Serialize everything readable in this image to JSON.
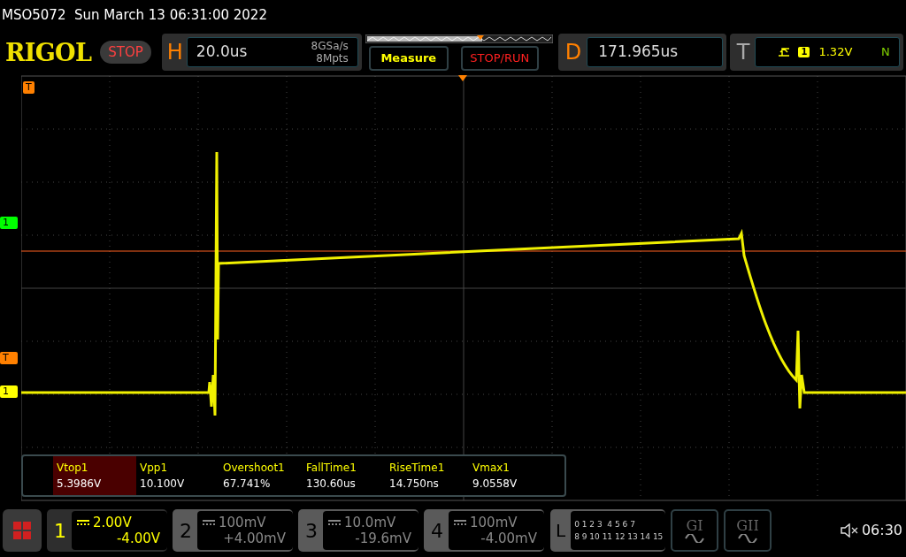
{
  "title": "MSO5072  Sun March 13 06:31:00 2022",
  "logo": "RIGOL",
  "run_state": "STOP",
  "horizontal": {
    "label": "H",
    "timebase": "20.0us",
    "sample_rate": "8GSa/s",
    "memory_depth": "8Mpts"
  },
  "buttons": [
    "Measure",
    "STOP/RUN"
  ],
  "delay": {
    "label": "D",
    "value": "171.965us"
  },
  "trigger": {
    "label": "T",
    "source": "1",
    "level": "1.32V",
    "mode": "N"
  },
  "markers": [
    {
      "label": "T",
      "color": "#ff8000"
    },
    {
      "label": "1",
      "color": "#00ff00"
    },
    {
      "label": "T",
      "color": "#ff8000"
    },
    {
      "label": "1",
      "color": "#ffff00"
    }
  ],
  "measurements": [
    {
      "name": "Vtop1",
      "value": "5.3986V",
      "selected": true
    },
    {
      "name": "Vpp1",
      "value": "10.100V",
      "selected": false
    },
    {
      "name": "Overshoot1",
      "value": "67.741%",
      "selected": false
    },
    {
      "name": "FallTime1",
      "value": "130.60us",
      "selected": false
    },
    {
      "name": "RiseTime1",
      "value": "14.750ns",
      "selected": false
    },
    {
      "name": "Vmax1",
      "value": "9.0558V",
      "selected": false
    }
  ],
  "channels": [
    {
      "number": "1",
      "scale": "2.00V",
      "offset": "-4.00V",
      "on": true
    },
    {
      "number": "2",
      "scale": "100mV",
      "offset": "+4.00mV",
      "on": false
    },
    {
      "number": "3",
      "scale": "10.0mV",
      "offset": "-19.6mV",
      "on": false
    },
    {
      "number": "4",
      "scale": "100mV",
      "offset": "-4.00mV",
      "on": false
    }
  ],
  "logic": {
    "label": "L",
    "rows": [
      "0 1 2 3  4 5 6 7",
      "8 9 10 11 12 13 14 15"
    ]
  },
  "generators": [
    "GI",
    "GII"
  ],
  "clock": "06:30"
}
